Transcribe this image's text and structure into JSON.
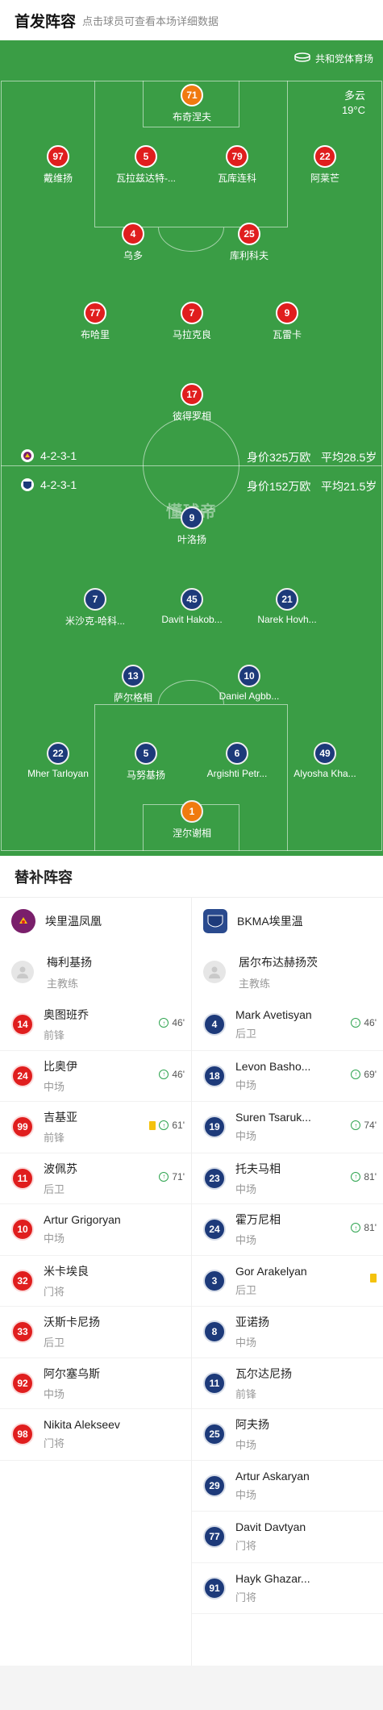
{
  "header": {
    "title": "首发阵容",
    "subtitle": "点击球员可查看本场详细数据"
  },
  "pitch": {
    "stadium": "共和党体育场",
    "weather": "多云",
    "temperature": "19°C",
    "watermark": "懂球帝",
    "home_info": {
      "formation": "4-2-3-1",
      "value": "身价325万欧",
      "age": "平均28.5岁"
    },
    "away_info": {
      "formation": "4-2-3-1",
      "value": "身价152万欧",
      "age": "平均21.5岁"
    }
  },
  "home_players": [
    {
      "num": "71",
      "name": "布奇涅夫",
      "gk": true
    },
    {
      "num": "97",
      "name": "戴维扬",
      "sub": "71'"
    },
    {
      "num": "5",
      "name": "瓦拉兹达特-..."
    },
    {
      "num": "79",
      "name": "瓦库连科"
    },
    {
      "num": "22",
      "name": "阿莱芒"
    },
    {
      "num": "4",
      "name": "乌多"
    },
    {
      "num": "25",
      "name": "库利科夫",
      "yellow": true,
      "sub": "61'"
    },
    {
      "num": "77",
      "name": "布哈里"
    },
    {
      "num": "7",
      "name": "马拉克良",
      "yellow": true,
      "sub": "46'"
    },
    {
      "num": "9",
      "name": "瓦雷卡",
      "goals": 1
    },
    {
      "num": "17",
      "name": "彼得罗相",
      "sub": "46'"
    }
  ],
  "away_players": [
    {
      "num": "9",
      "name": "叶洛扬",
      "goals": 2
    },
    {
      "num": "7",
      "name": "米沙克-哈科...",
      "sub": "69'"
    },
    {
      "num": "45",
      "name": "Davit Hakob...",
      "sub": "81'"
    },
    {
      "num": "21",
      "name": "Narek Hovh...",
      "sub": "74'"
    },
    {
      "num": "13",
      "name": "萨尔格相",
      "yellow": true
    },
    {
      "num": "10",
      "name": "Daniel Agbb...",
      "sub": "81'"
    },
    {
      "num": "22",
      "name": "Mher Tarloyan"
    },
    {
      "num": "5",
      "name": "马努基扬"
    },
    {
      "num": "6",
      "name": "Argishti Petr..."
    },
    {
      "num": "49",
      "name": "Alyosha Kha...",
      "sub": "46'"
    },
    {
      "num": "1",
      "name": "涅尔谢相",
      "gk": true
    }
  ],
  "subs": {
    "title": "替补阵容",
    "coach_role": "主教练",
    "home": {
      "team": "埃里温凤凰",
      "coach": "梅利基扬",
      "players": [
        {
          "num": "14",
          "name": "奥图班乔",
          "pos": "前锋",
          "sub": "46'"
        },
        {
          "num": "24",
          "name": "比奥伊",
          "pos": "中场",
          "sub": "46'"
        },
        {
          "num": "99",
          "name": "吉基亚",
          "pos": "前锋",
          "yellow": true,
          "sub": "61'"
        },
        {
          "num": "11",
          "name": "波佩苏",
          "pos": "后卫",
          "sub": "71'"
        },
        {
          "num": "10",
          "name": "Artur Grigoryan",
          "pos": "中场"
        },
        {
          "num": "32",
          "name": "米卡埃良",
          "pos": "门将"
        },
        {
          "num": "33",
          "name": "沃斯卡尼扬",
          "pos": "后卫"
        },
        {
          "num": "92",
          "name": "阿尔塞乌斯",
          "pos": "中场"
        },
        {
          "num": "98",
          "name": "Nikita Alekseev",
          "pos": "门将"
        }
      ]
    },
    "away": {
      "team": "BKMA埃里温",
      "coach": "居尔布达赫扬茨",
      "players": [
        {
          "num": "4",
          "name": "Mark Avetisyan",
          "pos": "后卫",
          "sub": "46'"
        },
        {
          "num": "18",
          "name": "Levon Basho...",
          "pos": "中场",
          "sub": "69'"
        },
        {
          "num": "19",
          "name": "Suren Tsaruk...",
          "pos": "中场",
          "sub": "74'"
        },
        {
          "num": "23",
          "name": "托夫马相",
          "pos": "中场",
          "sub": "81'"
        },
        {
          "num": "24",
          "name": "霍万尼相",
          "pos": "中场",
          "sub": "81'"
        },
        {
          "num": "3",
          "name": "Gor Arakelyan",
          "pos": "后卫",
          "yellow": true
        },
        {
          "num": "8",
          "name": "亚诺扬",
          "pos": "中场"
        },
        {
          "num": "11",
          "name": "瓦尔达尼扬",
          "pos": "前锋"
        },
        {
          "num": "25",
          "name": "阿夫扬",
          "pos": "中场"
        },
        {
          "num": "29",
          "name": "Artur Askaryan",
          "pos": "中场"
        },
        {
          "num": "77",
          "name": "Davit Davtyan",
          "pos": "门将"
        },
        {
          "num": "91",
          "name": "Hayk Ghazar...",
          "pos": "门将"
        }
      ]
    }
  },
  "colors": {
    "pitch": "#3a9d45",
    "home": "#e01e1e",
    "away": "#1d3a7a",
    "gk": "#f07a10",
    "yellow_card": "#f4c20d",
    "sub_in": "#2ea44f"
  }
}
